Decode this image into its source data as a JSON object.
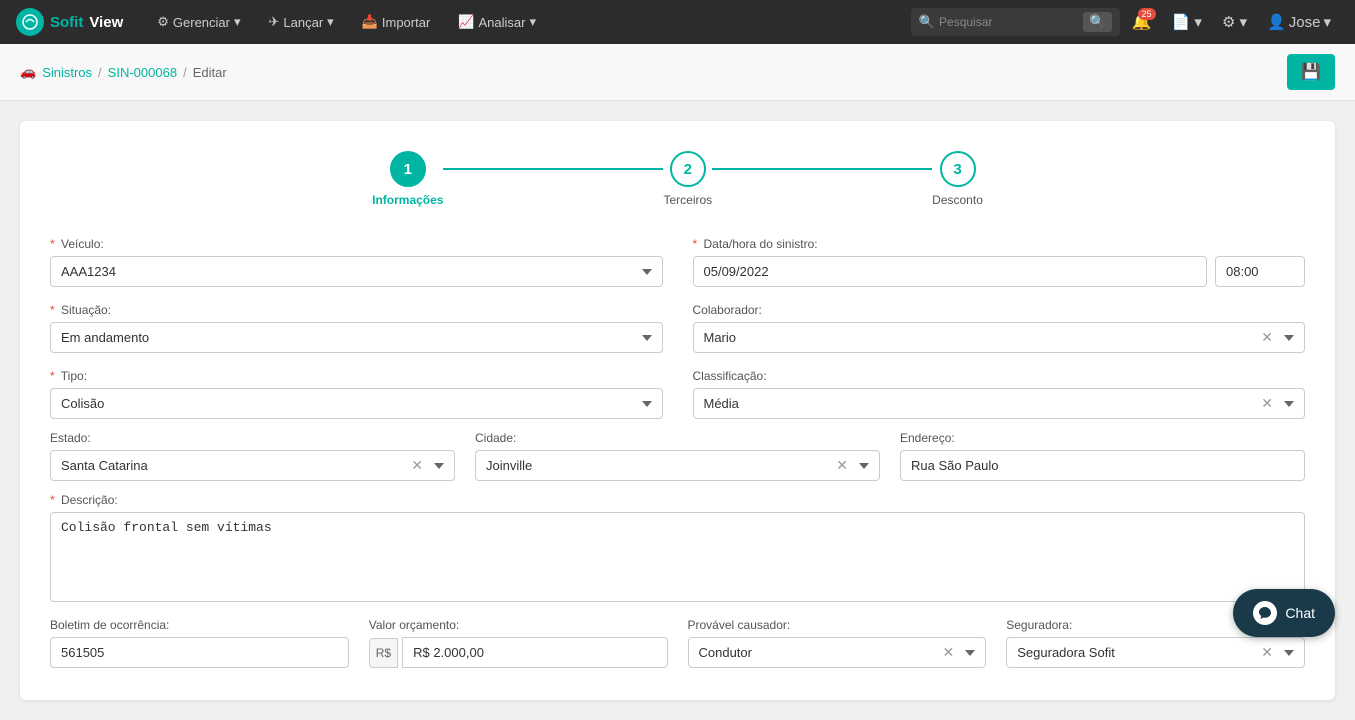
{
  "brand": {
    "sofit": "Sofit",
    "view": "View"
  },
  "navbar": {
    "gerenciar": "Gerenciar",
    "lancar": "Lançar",
    "importar": "Importar",
    "analisar": "Analisar",
    "search_placeholder": "Pesquisar",
    "notif_count": "25",
    "user": "Jose"
  },
  "breadcrumb": {
    "sinistros": "Sinistros",
    "sin_number": "SIN-000068",
    "current": "Editar"
  },
  "stepper": {
    "steps": [
      {
        "number": "1",
        "label": "Informações",
        "active": true
      },
      {
        "number": "2",
        "label": "Terceiros",
        "active": false
      },
      {
        "number": "3",
        "label": "Desconto",
        "active": false
      }
    ]
  },
  "form": {
    "veiculo_label": "Veículo:",
    "veiculo_value": "AAA1234",
    "data_hora_label": "Data/hora do sinistro:",
    "data_value": "05/09/2022",
    "hora_value": "08:00",
    "situacao_label": "Situação:",
    "situacao_value": "Em andamento",
    "colaborador_label": "Colaborador:",
    "colaborador_value": "Mario",
    "tipo_label": "Tipo:",
    "tipo_value": "Colisão",
    "classificacao_label": "Classificação:",
    "classificacao_value": "Média",
    "estado_label": "Estado:",
    "estado_value": "Santa Catarina",
    "cidade_label": "Cidade:",
    "cidade_value": "Joinville",
    "endereco_label": "Endereço:",
    "endereco_value": "Rua São Paulo",
    "descricao_label": "Descrição:",
    "descricao_value": "Colisão frontal sem vítimas",
    "boletim_label": "Boletim de ocorrência:",
    "boletim_value": "561505",
    "valor_orcamento_label": "Valor orçamento:",
    "valor_prefix": "R$",
    "valor_value": "R$ 2.000,00",
    "provavel_causador_label": "Provável causador:",
    "provavel_causador_value": "Condutor",
    "seguradora_label": "Seguradora:",
    "seguradora_value": "Seguradora Sofit"
  },
  "chat": {
    "label": "Chat"
  }
}
